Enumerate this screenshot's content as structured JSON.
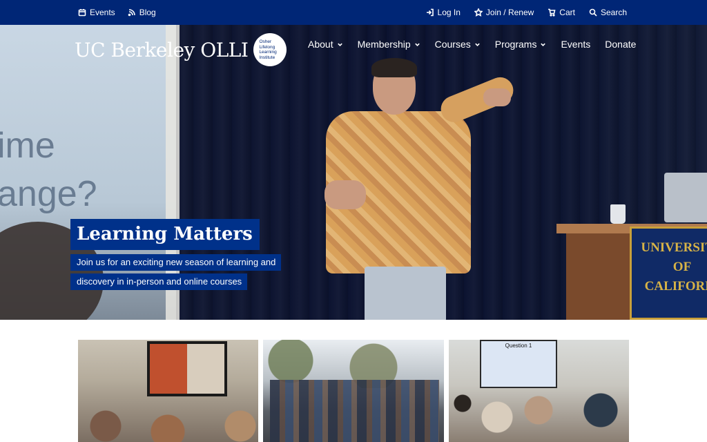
{
  "utility": {
    "events_label": "Events",
    "blog_label": "Blog",
    "login_label": "Log In",
    "join_label": "Join / Renew",
    "cart_label": "Cart",
    "search_label": "Search"
  },
  "brand": {
    "name": "UC Berkeley OLLI",
    "badge_line1": "Osher",
    "badge_line2": "Lifelong",
    "badge_line3": "Learning",
    "badge_line4": "Institute"
  },
  "nav": {
    "items": [
      {
        "label": "About",
        "dropdown": true
      },
      {
        "label": "Membership",
        "dropdown": true
      },
      {
        "label": "Courses",
        "dropdown": true
      },
      {
        "label": "Programs",
        "dropdown": true
      },
      {
        "label": "Events",
        "dropdown": false
      },
      {
        "label": "Donate",
        "dropdown": false
      }
    ]
  },
  "hero": {
    "title": "Learning Matters",
    "subtitle_line1": "Join us for an exciting new season of learning and",
    "subtitle_line2": "discovery in in-person and online courses",
    "screen_text_line1": "ime",
    "screen_text_line2": "ange?",
    "podium_line1": "UNIVERSITY",
    "podium_line2": "OF",
    "podium_line3": "CALIFORNI"
  },
  "cards": {
    "card3_screen_title": "Question 1"
  },
  "colors": {
    "brand_blue": "#002676",
    "hero_label_blue": "#00318a",
    "berkeley_gold": "#c9a03a"
  }
}
